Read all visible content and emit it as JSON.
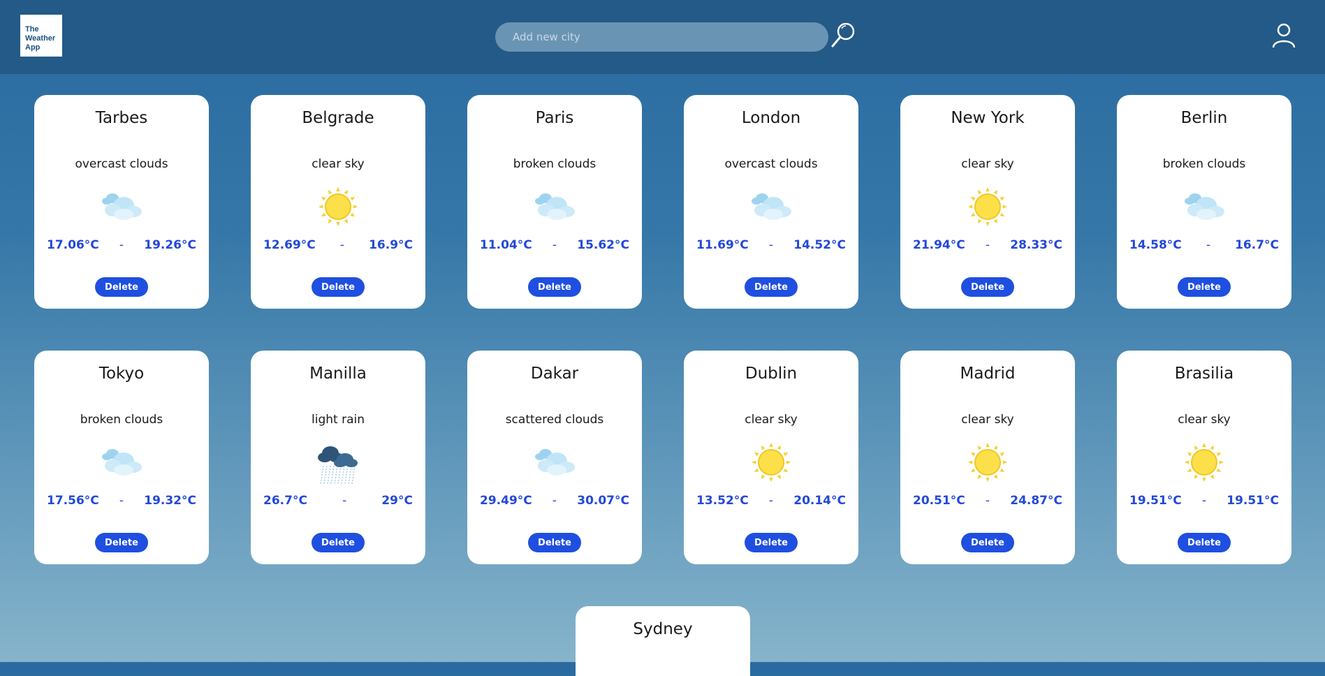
{
  "app": {
    "logo_lines": [
      "The",
      "Weather",
      "App"
    ]
  },
  "search": {
    "placeholder": "Add new city",
    "value": ""
  },
  "icons": {
    "search": "magnifier-icon",
    "user": "user-icon"
  },
  "colors": {
    "header": "#235a87",
    "temp": "#2348d9",
    "delete_button": "#1f4fe0"
  },
  "cities": [
    {
      "name": "Tarbes",
      "description": "overcast clouds",
      "icon": "clouds",
      "min": "17.06°C",
      "sep": "-",
      "max": "19.26°C",
      "delete_label": "Delete"
    },
    {
      "name": "Belgrade",
      "description": "clear sky",
      "icon": "sun",
      "min": "12.69°C",
      "sep": "-",
      "max": "16.9°C",
      "delete_label": "Delete"
    },
    {
      "name": "Paris",
      "description": "broken clouds",
      "icon": "clouds",
      "min": "11.04°C",
      "sep": "-",
      "max": "15.62°C",
      "delete_label": "Delete"
    },
    {
      "name": "London",
      "description": "overcast clouds",
      "icon": "clouds",
      "min": "11.69°C",
      "sep": "-",
      "max": "14.52°C",
      "delete_label": "Delete"
    },
    {
      "name": "New York",
      "description": "clear sky",
      "icon": "sun",
      "min": "21.94°C",
      "sep": "-",
      "max": "28.33°C",
      "delete_label": "Delete"
    },
    {
      "name": "Berlin",
      "description": "broken clouds",
      "icon": "clouds",
      "min": "14.58°C",
      "sep": "-",
      "max": "16.7°C",
      "delete_label": "Delete"
    },
    {
      "name": "Tokyo",
      "description": "broken clouds",
      "icon": "clouds",
      "min": "17.56°C",
      "sep": "-",
      "max": "19.32°C",
      "delete_label": "Delete"
    },
    {
      "name": "Manilla",
      "description": "light rain",
      "icon": "rain",
      "min": "26.7°C",
      "sep": "-",
      "max": "29°C",
      "delete_label": "Delete"
    },
    {
      "name": "Dakar",
      "description": "scattered clouds",
      "icon": "clouds",
      "min": "29.49°C",
      "sep": "-",
      "max": "30.07°C",
      "delete_label": "Delete"
    },
    {
      "name": "Dublin",
      "description": "clear sky",
      "icon": "sun",
      "min": "13.52°C",
      "sep": "-",
      "max": "20.14°C",
      "delete_label": "Delete"
    },
    {
      "name": "Madrid",
      "description": "clear sky",
      "icon": "sun",
      "min": "20.51°C",
      "sep": "-",
      "max": "24.87°C",
      "delete_label": "Delete"
    },
    {
      "name": "Brasilia",
      "description": "clear sky",
      "icon": "sun",
      "min": "19.51°C",
      "sep": "-",
      "max": "19.51°C",
      "delete_label": "Delete"
    },
    {
      "name": "Sydney"
    }
  ]
}
